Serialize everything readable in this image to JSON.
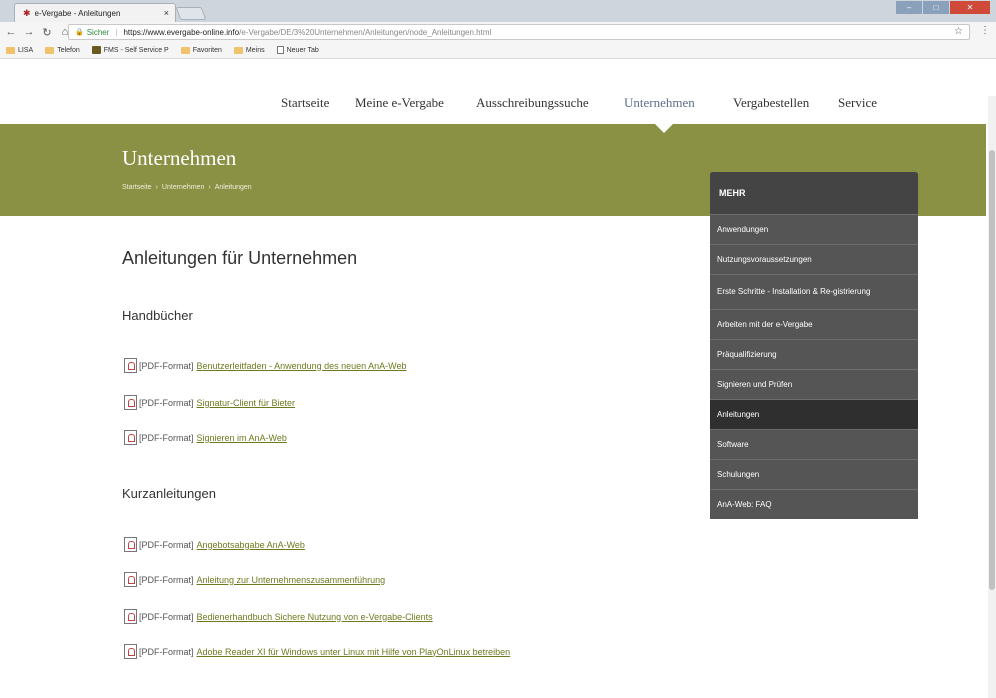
{
  "browser": {
    "tab_title": "e-Vergabe - Anleitungen",
    "tab_close": "×",
    "secure_label": "Sicher",
    "url_host": "https://www.evergabe-online.info",
    "url_path": "/e-Vergabe/DE/3%20Unternehmen/Anleitungen/node_Anleitungen.html",
    "bookmarks": [
      "LISA",
      "Telefon",
      "FMS - Self Service P",
      "Favoriten",
      "Meins",
      "Neuer Tab"
    ]
  },
  "mainnav": [
    "Startseite",
    "Meine e-Vergabe",
    "Ausschreibungssuche",
    "Unternehmen",
    "Vergabestellen",
    "Service"
  ],
  "banner": {
    "title": "Unternehmen",
    "breadcrumb": [
      "Startseite",
      "Unternehmen",
      "Anleitungen"
    ],
    "crumb_sep": "›"
  },
  "sidenav": {
    "heading": "MEHR",
    "items": [
      "Anwendungen",
      "Nutzungsvoraussetzungen",
      "Erste Schritte - Installation & Re-gistrierung",
      "Arbeiten mit der e-Vergabe",
      "Präqualifizierung",
      "Signieren und Prüfen",
      "Anleitungen",
      "Software",
      "Schulungen",
      "AnA-Web: FAQ"
    ],
    "active_index": 6
  },
  "content": {
    "title": "Anleitungen für Unternehmen",
    "format_label": "[PDF-Format]",
    "sections": [
      {
        "heading": "Handbücher",
        "docs": [
          "Benutzerleitfaden - Anwendung des neuen AnA-Web",
          "Signatur-Client für Bieter",
          "Signieren im AnA-Web"
        ]
      },
      {
        "heading": "Kurzanleitungen",
        "docs": [
          "Angebotsabgabe AnA-Web",
          "Anleitung zur Unternehmenszusammenführung",
          "Bedienerhandbuch Sichere Nutzung von e-Vergabe-Clients",
          "Adobe Reader XI für Windows unter Linux mit Hilfe von PlayOnLinux betreiben"
        ]
      }
    ]
  },
  "colors": {
    "banner": "#8b9144",
    "link": "#6f7a1f",
    "nav_active": "#5e6b8d",
    "sidenav_bg": "#555555",
    "sidenav_active": "#2f2f2f"
  }
}
